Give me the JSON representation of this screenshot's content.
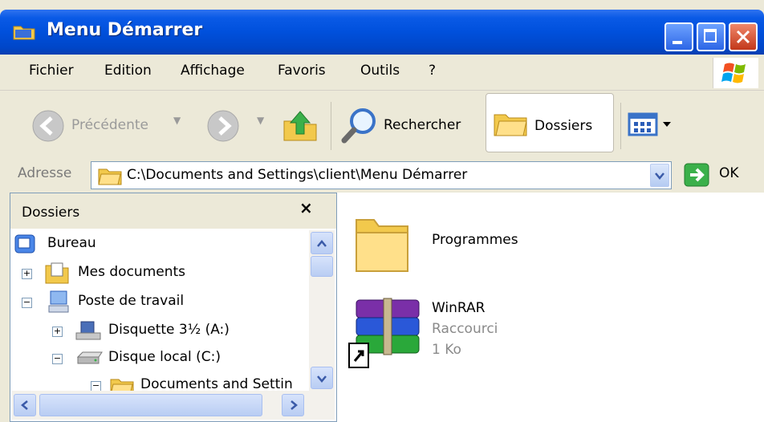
{
  "window": {
    "title": "Menu Démarrer"
  },
  "menubar": {
    "items": [
      "Fichier",
      "Edition",
      "Affichage",
      "Favoris",
      "Outils",
      "?"
    ]
  },
  "toolbar": {
    "back_label": "Précédente",
    "search_label": "Rechercher",
    "folders_label": "Dossiers"
  },
  "address": {
    "label": "Adresse",
    "value": "C:\\Documents and Settings\\client\\Menu Démarrer",
    "go_label": "OK"
  },
  "folders_pane": {
    "title": "Dossiers",
    "close_glyph": "×",
    "tree": [
      {
        "label": "Bureau",
        "icon": "desktop-icon",
        "expander": ""
      },
      {
        "label": "Mes documents",
        "icon": "my-documents-icon",
        "expander": "+"
      },
      {
        "label": "Poste de travail",
        "icon": "my-computer-icon",
        "expander": "−"
      },
      {
        "label": "Disquette 3½ (A:)",
        "icon": "floppy-drive-icon",
        "expander": "+"
      },
      {
        "label": "Disque local (C:)",
        "icon": "hard-drive-icon",
        "expander": "−"
      },
      {
        "label": "Documents and Settin",
        "icon": "folder-icon",
        "expander": "−"
      }
    ]
  },
  "files": [
    {
      "name": "Programmes",
      "type": "folder"
    },
    {
      "name": "WinRAR",
      "type": "Raccourci",
      "size": "1 Ko"
    }
  ],
  "colors": {
    "titlebar": "#0050dc",
    "chrome": "#ece9d8",
    "close_button": "#c2381a"
  }
}
